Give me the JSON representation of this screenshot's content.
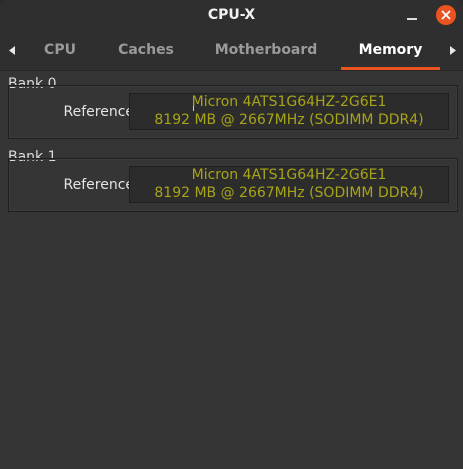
{
  "window": {
    "title": "CPU-X"
  },
  "titlebar": {
    "minimize_icon": "minimize-icon",
    "close_icon": "close-icon",
    "close_color": "#e95420"
  },
  "tabs": {
    "scroll_left_icon": "triangle-left-icon",
    "scroll_right_icon": "triangle-right-icon",
    "items": [
      {
        "label": "CPU",
        "active": false
      },
      {
        "label": "Caches",
        "active": false
      },
      {
        "label": "Motherboard",
        "active": false
      },
      {
        "label": "Memory",
        "active": true
      }
    ],
    "accent_color": "#e95420"
  },
  "memory": {
    "banks": [
      {
        "title": "Bank 0",
        "reference_label": "Reference",
        "reference_line1": "Micron 4ATS1G64HZ-2G6E1",
        "reference_line2": "8192 MB @ 2667MHz (SODIMM DDR4)"
      },
      {
        "title": "Bank 1",
        "reference_label": "Reference",
        "reference_line1": "Micron 4ATS1G64HZ-2G6E1",
        "reference_line2": "8192 MB @ 2667MHz (SODIMM DDR4)"
      }
    ],
    "value_color": "#a8a418"
  }
}
